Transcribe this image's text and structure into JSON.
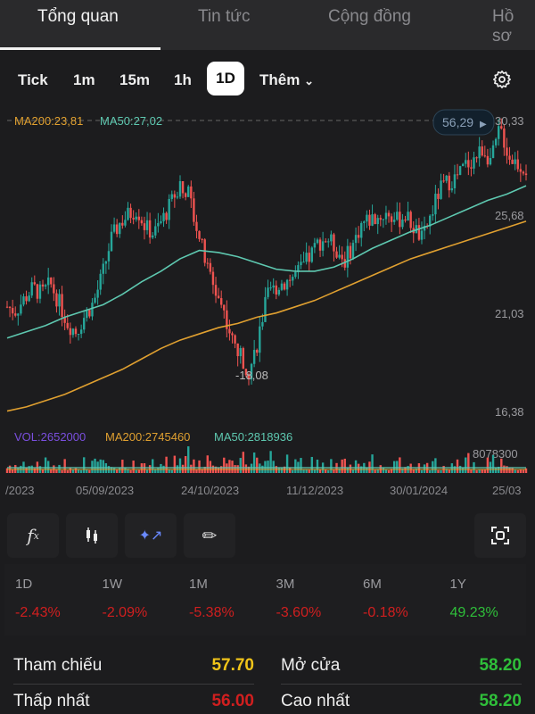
{
  "tabs": [
    "Tổng quan",
    "Tin tức",
    "Cộng đồng",
    "Hồ sơ"
  ],
  "timeframes": [
    "Tick",
    "1m",
    "15m",
    "1h",
    "1D"
  ],
  "more_label": "Thêm",
  "selected_timeframe": "1D",
  "colors": {
    "up": "#26a69a",
    "down": "#ef5350",
    "ma50": "#5ec8b0",
    "ma200": "#e0a030",
    "vol": "#7b4fe0",
    "yellow": "#f0c419",
    "green": "#2fbf3a",
    "red": "#d01f1f"
  },
  "chart_data": {
    "type": "candlestick",
    "legend": {
      "ma200": "MA200:23,81",
      "ma50": "MA50:27,02"
    },
    "price_badge": "56,29",
    "y_ticks": [
      "30,33",
      "25,68",
      "21,03",
      "16,38"
    ],
    "y_tick_values": [
      30.33,
      25.68,
      21.03,
      16.38
    ],
    "ylim": [
      16.38,
      30.33
    ],
    "low_label": "18,08",
    "x_ticks": [
      "/2023",
      "05/09/2023",
      "24/10/2023",
      "11/12/2023",
      "30/01/2024",
      "25/03"
    ],
    "closes": [
      21.4,
      21.2,
      21.8,
      22.3,
      22.0,
      22.5,
      21.6,
      20.6,
      20.2,
      21.0,
      21.6,
      22.9,
      24.6,
      25.4,
      25.8,
      26.1,
      25.2,
      24.9,
      25.6,
      26.4,
      27.4,
      26.8,
      25.2,
      23.4,
      22.3,
      21.3,
      19.8,
      19.0,
      18.3,
      19.8,
      21.8,
      22.3,
      22.6,
      22.8,
      23.2,
      23.8,
      24.5,
      24.7,
      24.2,
      23.6,
      24.4,
      25.4,
      25.6,
      25.7,
      25.9,
      25.5,
      25.8,
      25.2,
      24.6,
      25.8,
      27.0,
      27.4,
      27.6,
      28.2,
      28.5,
      29.0,
      28.4,
      30.0,
      28.6,
      28.3,
      28.0
    ],
    "ma50": [
      19.9,
      20.2,
      20.5,
      20.9,
      21.2,
      21.5,
      22.0,
      22.6,
      23.1,
      23.7,
      24.1,
      24.0,
      23.8,
      23.5,
      23.2,
      23.1,
      23.1,
      23.3,
      23.7,
      24.2,
      24.6,
      25.0,
      25.3,
      25.7,
      26.1,
      26.5,
      26.8,
      27.2
    ],
    "ma200": [
      16.4,
      16.6,
      16.9,
      17.2,
      17.6,
      18.0,
      18.4,
      18.9,
      19.4,
      19.8,
      20.1,
      20.4,
      20.6,
      20.9,
      21.1,
      21.4,
      21.7,
      22.1,
      22.5,
      22.9,
      23.3,
      23.7,
      24.0,
      24.3,
      24.6,
      24.9,
      25.2,
      25.5
    ],
    "volume_legend": {
      "vol": "VOL:2652000",
      "ma200": "MA200:2745460",
      "ma50": "MA50:2818936"
    },
    "volume_max_label": "8078300"
  },
  "tools": [
    "fx-icon",
    "candlestick-icon",
    "ai-sparkle-chart-icon",
    "pencil-icon",
    "fullscreen-icon"
  ],
  "performance": [
    {
      "label": "1D",
      "value": "-2.43%",
      "dir": "down"
    },
    {
      "label": "1W",
      "value": "-2.09%",
      "dir": "down"
    },
    {
      "label": "1M",
      "value": "-5.38%",
      "dir": "down"
    },
    {
      "label": "3M",
      "value": "-3.60%",
      "dir": "down"
    },
    {
      "label": "6M",
      "value": "-0.18%",
      "dir": "down"
    },
    {
      "label": "1Y",
      "value": "49.23%",
      "dir": "up"
    }
  ],
  "stats": {
    "ref_label": "Tham chiếu",
    "ref_value": "57.70",
    "open_label": "Mở cửa",
    "open_value": "58.20",
    "low_label": "Thấp nhất",
    "low_value": "56.00",
    "high_label": "Cao nhất",
    "high_value": "58.20"
  }
}
